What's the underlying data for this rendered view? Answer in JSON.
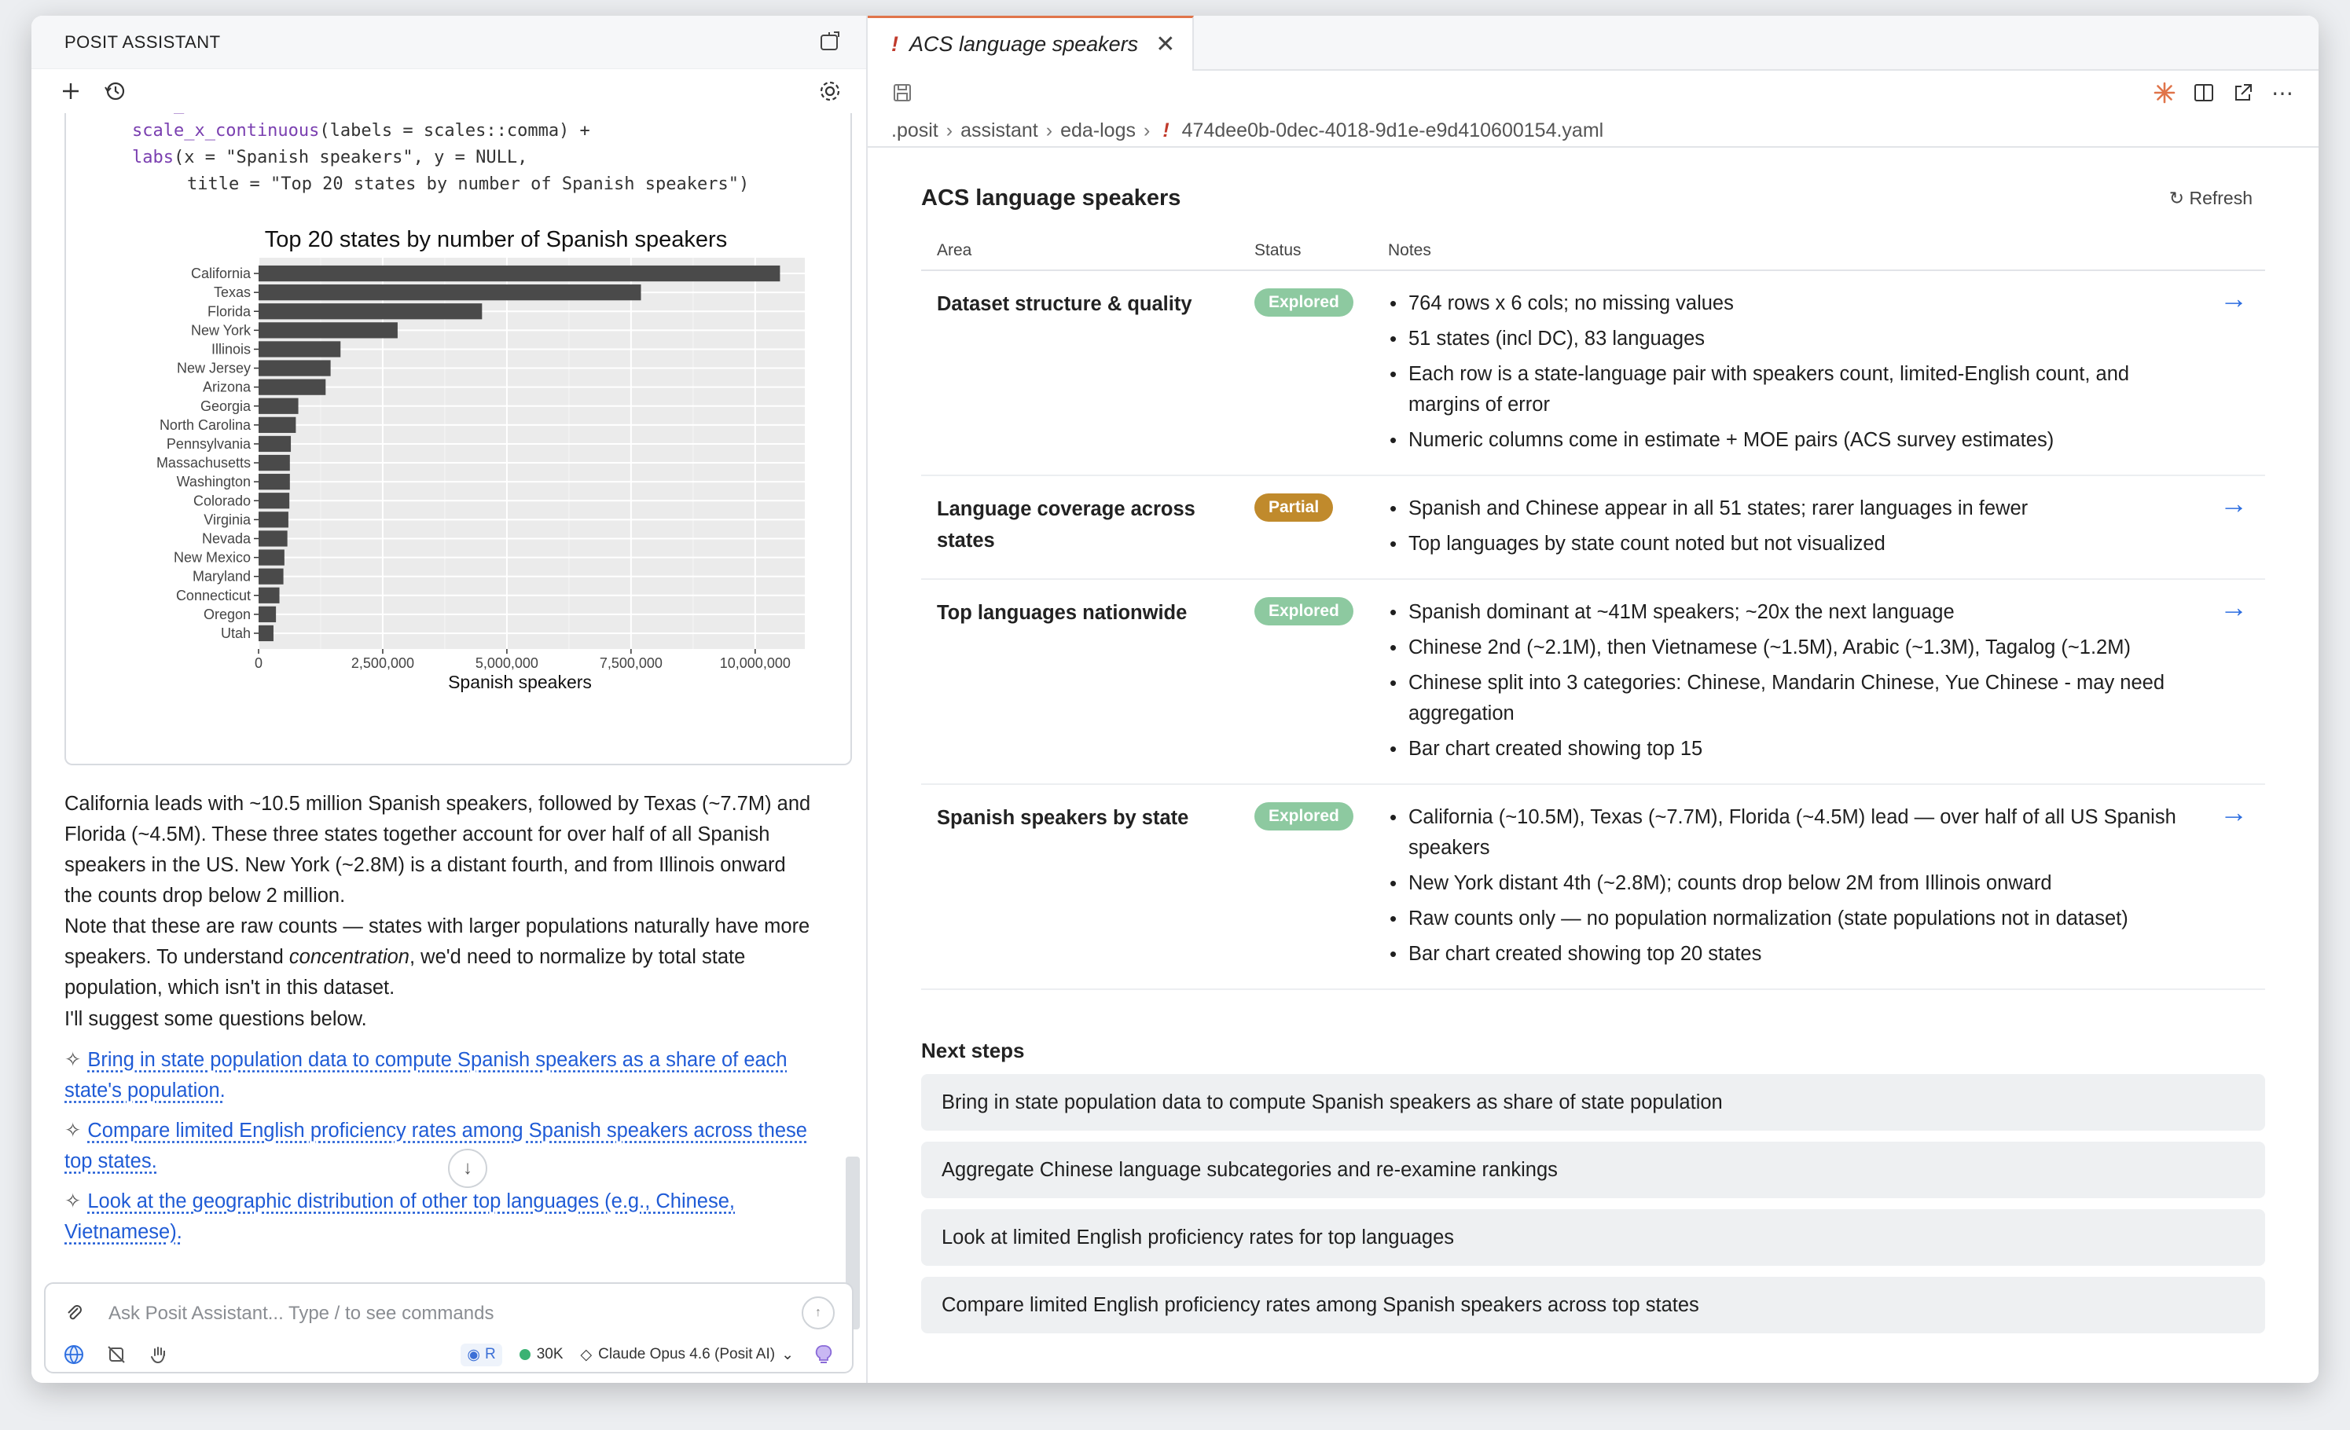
{
  "left_panel": {
    "title": "POSIT ASSISTANT",
    "code_lines": [
      {
        "fn": "geom_col",
        "rest": "() +"
      },
      {
        "fn": "scale_x_continuous",
        "rest": "(labels = scales::comma) +"
      },
      {
        "fn": "labs",
        "rest": "(x = \"Spanish speakers\", y = NULL,"
      },
      {
        "fn": "",
        "rest": "title = \"Top 20 states by number of Spanish speakers\")"
      }
    ],
    "paragraphs": [
      "California leads with ~10.5 million Spanish speakers, followed by Texas (~7.7M) and Florida (~4.5M). These three states together account for over half of all Spanish speakers in the US. New York (~2.8M) is a distant fourth, and from Illinois onward the counts drop below 2 million.",
      "I'll suggest some questions below."
    ],
    "note": {
      "before": "Note that these are raw counts — states with larger populations naturally have more speakers. To understand ",
      "em": "concentration",
      "after": ", we'd need to normalize by total state population, which isn't in this dataset."
    },
    "suggestions": [
      "Bring in state population data to compute Spanish speakers as a share of each state's population.",
      "Compare limited English proficiency rates among Spanish speakers across these top states.",
      "Look at the geographic distribution of other top languages (e.g., Chinese, Vietnamese)."
    ],
    "input": {
      "placeholder": "Ask Posit Assistant... Type / to see commands",
      "lang_chip": "R",
      "tokens": "30K",
      "model": "Claude Opus 4.6 (Posit AI)"
    }
  },
  "chart_data": {
    "type": "bar",
    "orientation": "horizontal",
    "title": "Top 20 states by number of Spanish speakers",
    "xlabel": "Spanish speakers",
    "ylabel": "",
    "xlim": [
      0,
      11000000
    ],
    "xticks": [
      0,
      2500000,
      5000000,
      7500000,
      10000000
    ],
    "xtick_labels": [
      "0",
      "2,500,000",
      "5,000,000",
      "7,500,000",
      "10,000,000"
    ],
    "grid": true,
    "bar_color": "#4a4a4a",
    "panel_color": "#ebebeb",
    "categories": [
      "California",
      "Texas",
      "Florida",
      "New York",
      "Illinois",
      "New Jersey",
      "Arizona",
      "Georgia",
      "North Carolina",
      "Pennsylvania",
      "Massachusetts",
      "Washington",
      "Colorado",
      "Virginia",
      "Nevada",
      "New Mexico",
      "Maryland",
      "Connecticut",
      "Oregon",
      "Utah"
    ],
    "values": [
      10500000,
      7700000,
      4500000,
      2800000,
      1650000,
      1450000,
      1350000,
      800000,
      750000,
      650000,
      630000,
      630000,
      620000,
      600000,
      580000,
      520000,
      500000,
      420000,
      350000,
      300000
    ]
  },
  "right_panel": {
    "tab_title": "ACS language speakers",
    "breadcrumbs": [
      ".posit",
      "assistant",
      "eda-logs",
      "474dee0b-0dec-4018-9d1e-e9d410600154.yaml"
    ],
    "doc_title": "ACS language speakers",
    "refresh_label": "Refresh",
    "columns": [
      "Area",
      "Status",
      "Notes"
    ],
    "rows": [
      {
        "area": "Dataset structure & quality",
        "status": "Explored",
        "notes": [
          "764 rows x 6 cols; no missing values",
          "51 states (incl DC), 83 languages",
          "Each row is a state-language pair with speakers count, limited-English count, and margins of error",
          "Numeric columns come in estimate + MOE pairs (ACS survey estimates)"
        ]
      },
      {
        "area": "Language coverage across states",
        "status": "Partial",
        "notes": [
          "Spanish and Chinese appear in all 51 states; rarer languages in fewer",
          "Top languages by state count noted but not visualized"
        ]
      },
      {
        "area": "Top languages nationwide",
        "status": "Explored",
        "notes": [
          "Spanish dominant at ~41M speakers; ~20x the next language",
          "Chinese 2nd (~2.1M), then Vietnamese (~1.5M), Arabic (~1.3M), Tagalog (~1.2M)",
          "Chinese split into 3 categories: Chinese, Mandarin Chinese, Yue Chinese - may need aggregation",
          "Bar chart created showing top 15"
        ]
      },
      {
        "area": "Spanish speakers by state",
        "status": "Explored",
        "notes": [
          "California (~10.5M), Texas (~7.7M), Florida (~4.5M) lead — over half of all US Spanish speakers",
          "New York distant 4th (~2.8M); counts drop below 2M from Illinois onward",
          "Raw counts only — no population normalization (state populations not in dataset)",
          "Bar chart created showing top 20 states"
        ]
      }
    ],
    "next_steps_title": "Next steps",
    "next_steps": [
      "Bring in state population data to compute Spanish speakers as share of state population",
      "Aggregate Chinese language subcategories and re-examine rankings",
      "Look at limited English proficiency rates for top languages",
      "Compare limited English proficiency rates among Spanish speakers across top states"
    ],
    "status_colors": {
      "Explored": "#8dc9a0",
      "Partial": "#c08a2c"
    }
  }
}
